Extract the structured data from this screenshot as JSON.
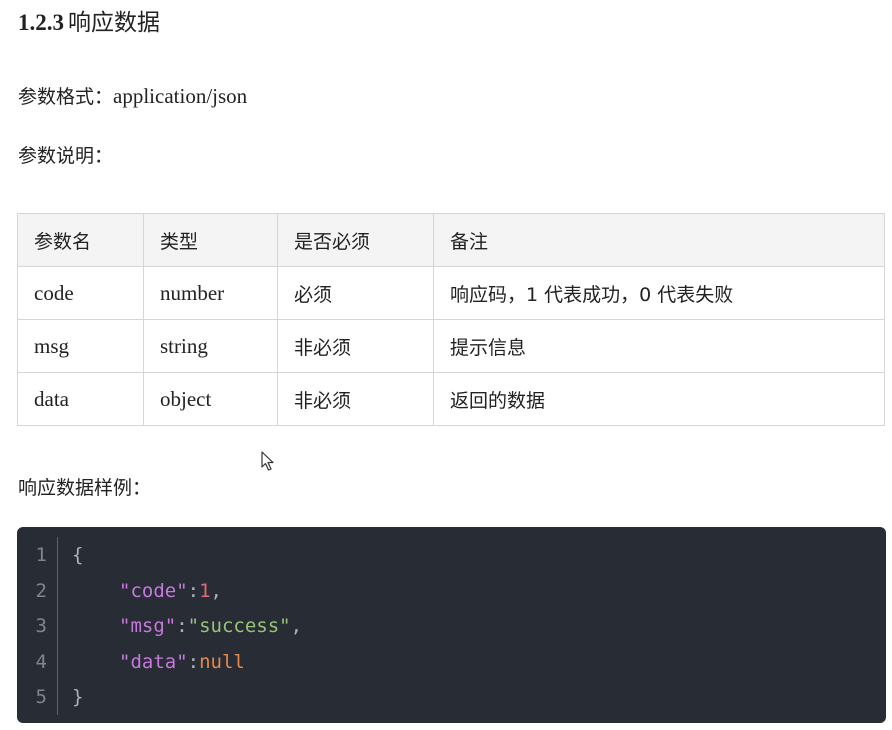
{
  "heading": {
    "number": "1.2.3",
    "title": "响应数据"
  },
  "format": {
    "label": "参数格式：",
    "value": "application/json"
  },
  "description_label": "参数说明：",
  "table": {
    "headers": [
      "参数名",
      "类型",
      "是否必须",
      "备注"
    ],
    "rows": [
      {
        "name": "code",
        "type": "number",
        "required": "必须",
        "remark": "响应码，1 代表成功，0 代表失败"
      },
      {
        "name": "msg",
        "type": "string",
        "required": "非必须",
        "remark": "提示信息"
      },
      {
        "name": "data",
        "type": "object",
        "required": "非必须",
        "remark": "返回的数据"
      }
    ]
  },
  "sample_label": "响应数据样例：",
  "code": {
    "line_numbers": [
      "1",
      "2",
      "3",
      "4",
      "5"
    ],
    "open_brace": "{",
    "close_brace": "}",
    "code_key": "\"code\"",
    "code_value": "1",
    "msg_key": "\"msg\"",
    "msg_value": "\"success\"",
    "data_key": "\"data\"",
    "data_value": "null",
    "colon": ":",
    "comma": ","
  },
  "colors": {
    "code_background": "#282c34",
    "key": "#c678dd",
    "number": "#e06c75",
    "string": "#98c379",
    "null": "#e5894b"
  }
}
